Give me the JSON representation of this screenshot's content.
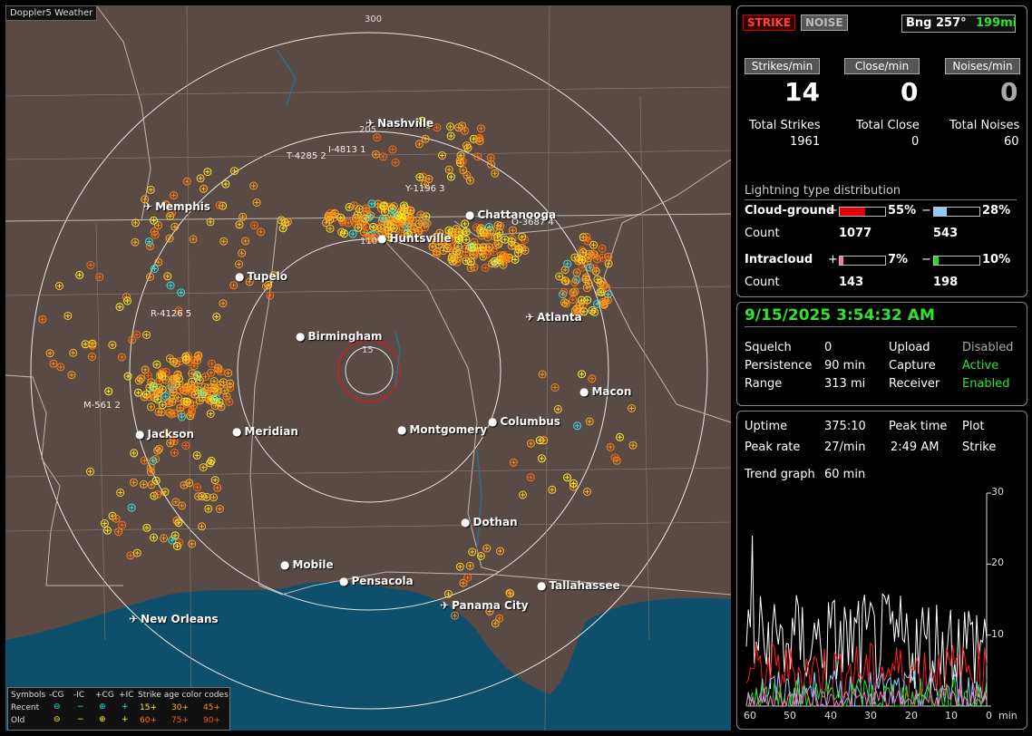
{
  "app": {
    "title": "Doppler5 Weather"
  },
  "map": {
    "range_labels": [
      "300",
      "205",
      "110",
      "15"
    ],
    "cities": [
      {
        "name": "Nashville",
        "type": "airport"
      },
      {
        "name": "Memphis",
        "type": "airport"
      },
      {
        "name": "Chattanooga",
        "type": "dot"
      },
      {
        "name": "Huntsville",
        "type": "dot"
      },
      {
        "name": "Tupelo",
        "type": "dot"
      },
      {
        "name": "Atlanta",
        "type": "airport"
      },
      {
        "name": "Birmingham",
        "type": "dot"
      },
      {
        "name": "Macon",
        "type": "dot"
      },
      {
        "name": "Jackson",
        "type": "dot"
      },
      {
        "name": "Meridian",
        "type": "dot"
      },
      {
        "name": "Montgomery",
        "type": "dot"
      },
      {
        "name": "Columbus",
        "type": "dot"
      },
      {
        "name": "Dothan",
        "type": "dot"
      },
      {
        "name": "Mobile",
        "type": "dot"
      },
      {
        "name": "Pensacola",
        "type": "dot"
      },
      {
        "name": "Tallahassee",
        "type": "dot"
      },
      {
        "name": "Panama City",
        "type": "airport"
      },
      {
        "name": "New Orleans",
        "type": "airport"
      }
    ],
    "storm_tags": [
      "I-4813 1",
      "T-4285 2",
      "Y-1196 3",
      "O-3687 4",
      "R-4126 5",
      "M-561 2"
    ]
  },
  "legend": {
    "symbols_label": "Symbols",
    "neg_cg": "-CG",
    "neg_ic": "-IC",
    "pos_cg": "+CG",
    "pos_ic": "+IC",
    "age_title": "Strike age color codes",
    "recent": "Recent",
    "old": "Old",
    "ages_recent": [
      "15+",
      "30+",
      "45+"
    ],
    "ages_old": [
      "60+",
      "75+",
      "90+"
    ]
  },
  "status": {
    "strike_label": "STRIKE",
    "noise_label": "NOISE",
    "bearing": "Bng 257°",
    "distance": "199mi",
    "rate_labels": [
      "Strikes/min",
      "Close/min",
      "Noises/min"
    ],
    "rates": [
      "14",
      "0",
      "0"
    ],
    "total_labels": [
      "Total Strikes",
      "Total Close",
      "Total Noises"
    ],
    "totals": [
      "1961",
      "0",
      "60"
    ],
    "dist_title": "Lightning type distribution",
    "cg_label": "Cloud-ground",
    "ic_label": "Intracloud",
    "count_label": "Count",
    "plus": "+",
    "minus": "−",
    "cg_pos_pct": "55%",
    "cg_neg_pct": "28%",
    "cg_pos_count": "1077",
    "cg_neg_count": "543",
    "ic_pos_pct": "7%",
    "ic_neg_pct": "10%",
    "ic_pos_count": "143",
    "ic_neg_count": "198",
    "cg_pos_fraction": 0.55,
    "cg_neg_fraction": 0.28,
    "ic_pos_fraction": 0.07,
    "ic_neg_fraction": 0.1
  },
  "settings": {
    "datetime": "9/15/2025 3:54:32 AM",
    "squelch_label": "Squelch",
    "squelch": "0",
    "persistence_label": "Persistence",
    "persistence": "90 min",
    "range_label": "Range",
    "range": "313 mi",
    "upload_label": "Upload",
    "upload": "Disabled",
    "capture_label": "Capture",
    "capture": "Active",
    "receiver_label": "Receiver",
    "receiver": "Enabled"
  },
  "stats": {
    "uptime_label": "Uptime",
    "uptime": "375:10",
    "peak_time_label": "Peak time",
    "peak_time": "2:49 AM",
    "plot_label": "Plot",
    "plot": "Strike",
    "peak_rate_label": "Peak rate",
    "peak_rate": "27/min",
    "trend_label": "Trend graph",
    "trend": "60 min",
    "y_ticks": [
      "30",
      "20",
      "10"
    ],
    "x_ticks": [
      "60",
      "50",
      "40",
      "30",
      "20",
      "10",
      "0"
    ],
    "x_unit": "min",
    "colors": {
      "total": "#ffffff",
      "pos_cg": "#ff2020",
      "neg_cg": "#8ecbff",
      "pos_ic": "#ff70c0",
      "neg_ic": "#22dd22"
    }
  }
}
